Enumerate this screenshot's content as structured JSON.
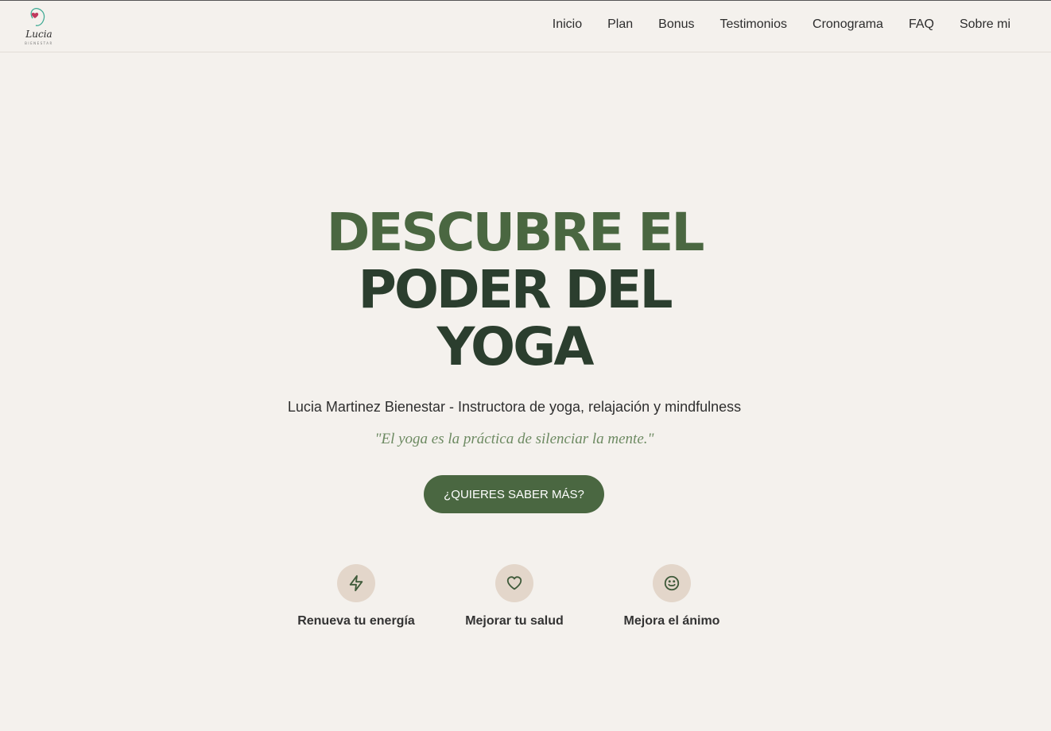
{
  "brand": {
    "name": "Lucia",
    "tagline": "BIENESTAR"
  },
  "nav": {
    "items": [
      "Inicio",
      "Plan",
      "Bonus",
      "Testimonios",
      "Cronograma",
      "FAQ",
      "Sobre mi"
    ]
  },
  "hero": {
    "title_line1": "DESCUBRE EL",
    "title_line2": "PODER DEL",
    "title_line3": "YOGA",
    "subtitle": "Lucia Martinez Bienestar - Instructora de yoga, relajación y mindfulness",
    "quote": "\"El yoga es la práctica de silenciar la mente.\"",
    "cta_label": "¿QUIERES SABER MÁS?"
  },
  "features": [
    {
      "icon": "lightning-icon",
      "label": "Renueva tu energía"
    },
    {
      "icon": "heart-icon",
      "label": "Mejorar tu salud"
    },
    {
      "icon": "smile-icon",
      "label": "Mejora el ánimo"
    }
  ],
  "colors": {
    "accent": "#4a6741",
    "dark_green": "#2b3e2e",
    "quote_green": "#6d8a62",
    "background": "#f4f1ed",
    "icon_circle": "#e3d6ca",
    "logo_heart": "#c03a5e",
    "logo_ring": "#3aa892"
  }
}
